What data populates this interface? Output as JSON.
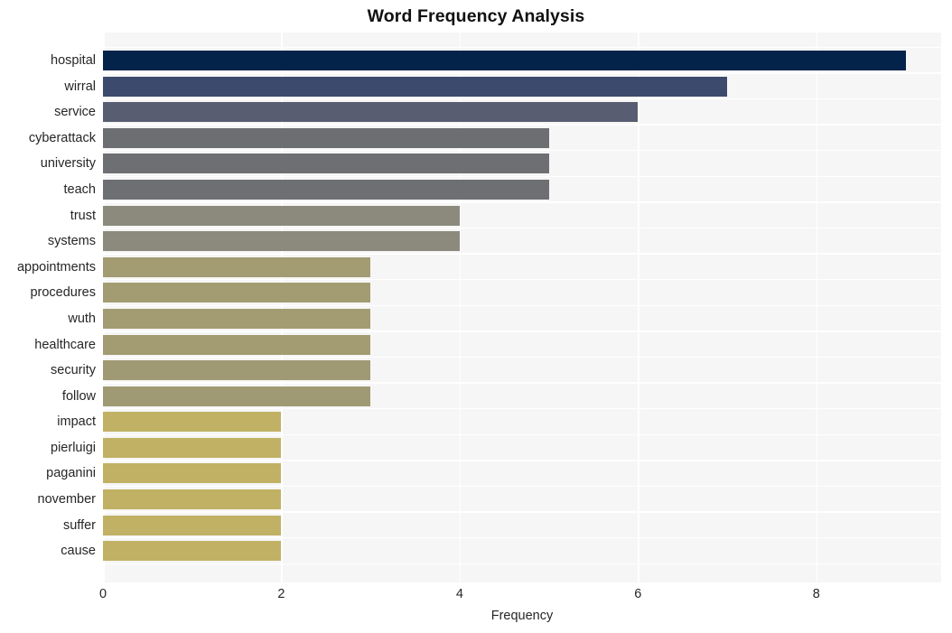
{
  "chart_data": {
    "type": "bar",
    "orientation": "horizontal",
    "title": "Word Frequency Analysis",
    "xlabel": "Frequency",
    "ylabel": "",
    "xlim": [
      0,
      9.4
    ],
    "xticks": [
      0,
      2,
      4,
      6,
      8
    ],
    "xtick_labels": [
      "0",
      "2",
      "4",
      "6",
      "8"
    ],
    "grid": true,
    "legend": null,
    "categories": [
      "hospital",
      "wirral",
      "service",
      "cyberattack",
      "university",
      "teach",
      "trust",
      "systems",
      "appointments",
      "procedures",
      "wuth",
      "healthcare",
      "security",
      "follow",
      "impact",
      "pierluigi",
      "paganini",
      "november",
      "suffer",
      "cause"
    ],
    "values": [
      9,
      7,
      6,
      5,
      5,
      5,
      4,
      4,
      3,
      3,
      3,
      3,
      3,
      3,
      2,
      2,
      2,
      2,
      2,
      2
    ],
    "bar_colors": [
      "#03234b",
      "#3c4a6e",
      "#585d71",
      "#6d6e71",
      "#6e6f72",
      "#6e6f72",
      "#8b8a7d",
      "#8b8a7d",
      "#a39c72",
      "#a39c72",
      "#a39c72",
      "#a39c72",
      "#a09a74",
      "#a09a74",
      "#c0b164",
      "#c0b164",
      "#c0b164",
      "#c0b164",
      "#c0b164",
      "#c0b164"
    ]
  },
  "style": {
    "plot_background": "#f6f6f6",
    "grid_color": "#ffffff",
    "figure_background": "#ffffff",
    "text_color": "#262626",
    "title_color": "#111111"
  }
}
